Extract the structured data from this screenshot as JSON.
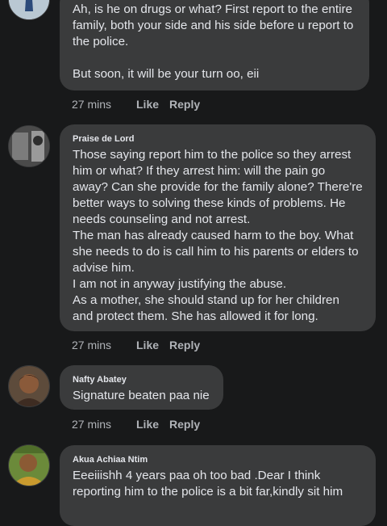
{
  "comments": [
    {
      "author": "",
      "text": "Ah, is he on drugs or what? First report to the entire family, both your side and his side before u report to the police.\n\nBut soon, it will be your turn oo, eii",
      "time": "27 mins",
      "like": "Like",
      "reply": "Reply"
    },
    {
      "author": "Praise de Lord",
      "text": "Those saying report him to the police so they arrest him or what? If they arrest him: will the pain go away? Can she provide for the family alone? There're better ways to solving these kinds of problems. He needs counseling and not arrest.\nThe man has already caused harm to the boy. What she needs to do is call him to his parents or elders to advise him.\nI am not in anyway justifying the abuse.\nAs a mother, she should stand up for her children and protect them. She has allowed it for long.",
      "time": "27 mins",
      "like": "Like",
      "reply": "Reply"
    },
    {
      "author": "Nafty Abatey",
      "text": "Signature beaten paa nie",
      "time": "27 mins",
      "like": "Like",
      "reply": "Reply"
    },
    {
      "author": "Akua Achiaa Ntim",
      "text": "Eeeiiishh 4 years paa oh too bad .Dear I think reporting him to the police is a bit far,kindly sit him"
    }
  ],
  "colors": {
    "background": "#18191a",
    "bubble": "#3a3b3c",
    "text": "#e4e6eb",
    "meta": "#b0b3b8"
  }
}
